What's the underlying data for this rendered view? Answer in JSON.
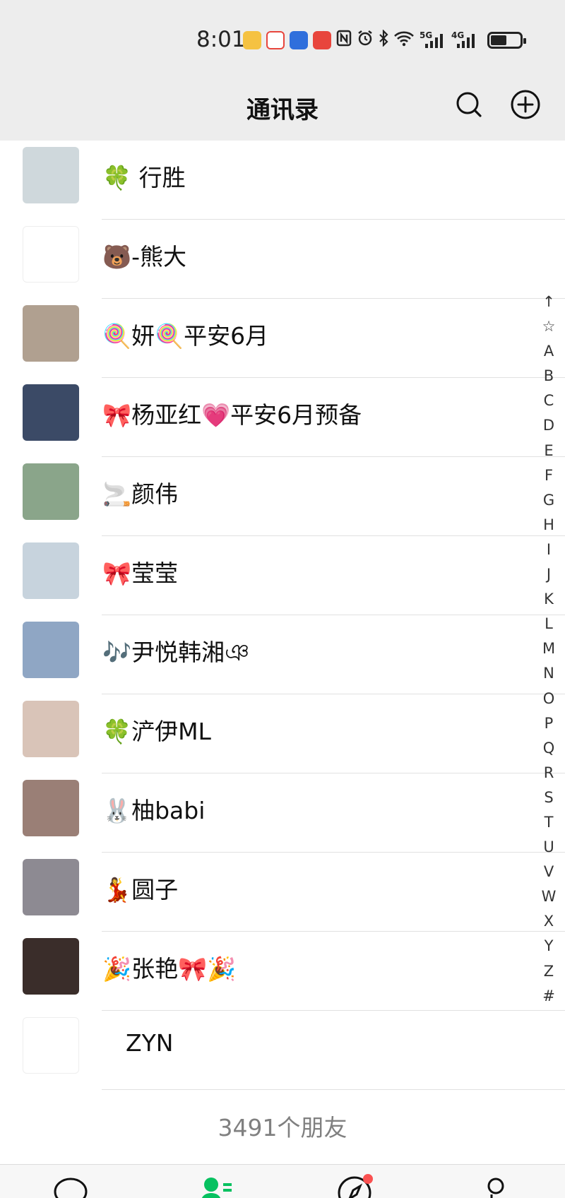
{
  "status_bar": {
    "time": "8:01",
    "app_icons": [
      {
        "name": "qr-code-app-icon",
        "color": "#f5c242"
      },
      {
        "name": "game-app-icon",
        "color": "#e8453c"
      },
      {
        "name": "download-app-icon",
        "color": "#2f6fdc"
      },
      {
        "name": "video-app-icon",
        "color": "#e8453c"
      }
    ],
    "system_icons": [
      "nfc-icon",
      "alarm-icon",
      "bluetooth-icon",
      "wifi-icon",
      "5g-signal-icon",
      "4g-signal-icon"
    ],
    "network_5g": "5G",
    "network_4g": "4G",
    "battery_level": 0.55
  },
  "header": {
    "title": "通讯录",
    "search_icon": "search-icon",
    "add_icon": "add-icon"
  },
  "contacts": [
    {
      "name": "🍀 行胜",
      "avatar_color": "#cfd8dc"
    },
    {
      "name": "🐻-熊大",
      "avatar_color": "#ffffff"
    },
    {
      "name": "🍭妍🍭平安6月",
      "avatar_color": "#b0a090"
    },
    {
      "name": "🎀杨亚红💗平安6月预备",
      "avatar_color": "#3b4a66"
    },
    {
      "name": "🚬颜伟",
      "avatar_color": "#8aa58a"
    },
    {
      "name": "🎀莹莹",
      "avatar_color": "#c7d3dd"
    },
    {
      "name": "🎶尹悦韩湘ঞ",
      "avatar_color": "#8fa6c4"
    },
    {
      "name": "🍀浐伊ML",
      "avatar_color": "#d9c4b8"
    },
    {
      "name": "🐰柚babi",
      "avatar_color": "#9a7f76"
    },
    {
      "name": "💃圆子",
      "avatar_color": "#8d8a92"
    },
    {
      "name": "🎉张艳🎀🎉",
      "avatar_color": "#3a2d2a"
    },
    {
      "name": "ZYN",
      "avatar_color": "#ffffff"
    }
  ],
  "friend_count": "3491个朋友",
  "index_letters": [
    "↑",
    "☆",
    "A",
    "B",
    "C",
    "D",
    "E",
    "F",
    "G",
    "H",
    "I",
    "J",
    "K",
    "L",
    "M",
    "N",
    "O",
    "P",
    "Q",
    "R",
    "S",
    "T",
    "U",
    "V",
    "W",
    "X",
    "Y",
    "Z",
    "#"
  ],
  "tabbar": {
    "tabs": [
      {
        "icon": "chat-bubble-icon",
        "active": false
      },
      {
        "icon": "contacts-icon",
        "active": true
      },
      {
        "icon": "discover-compass-icon",
        "active": false,
        "badge": true
      },
      {
        "icon": "me-person-icon",
        "active": false
      }
    ],
    "active_color": "#07c160",
    "badge_color": "#fa5151"
  }
}
